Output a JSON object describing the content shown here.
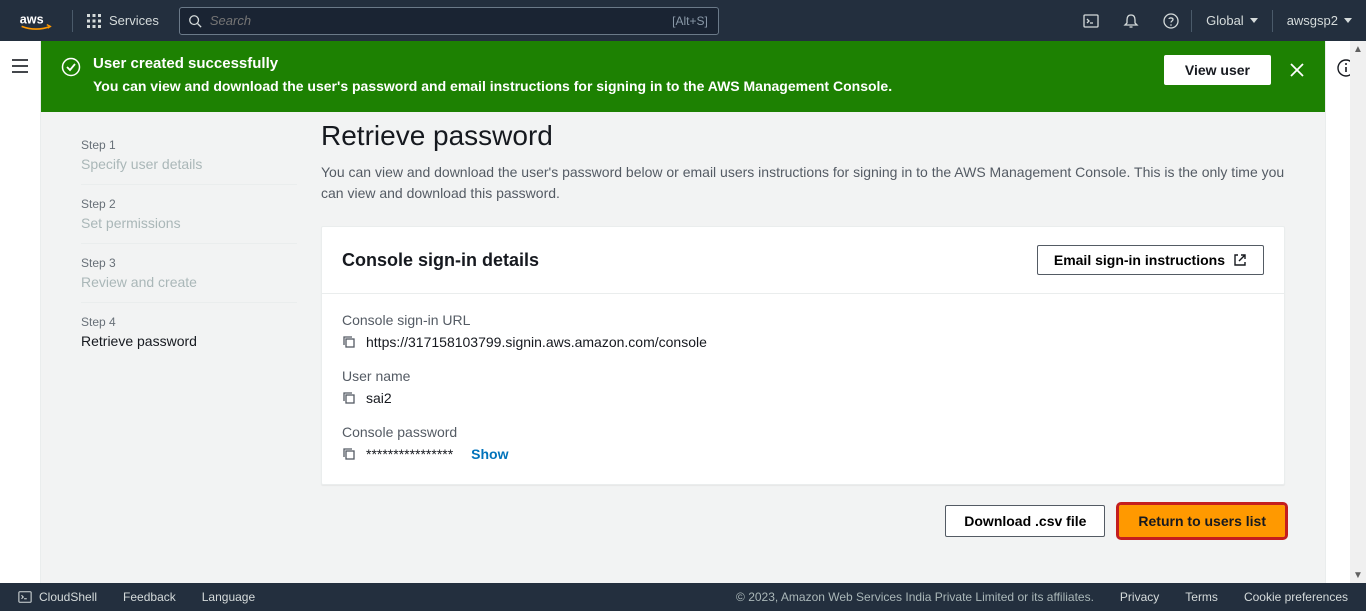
{
  "topnav": {
    "logo_text": "aws",
    "services_label": "Services",
    "search_placeholder": "Search",
    "search_hint": "[Alt+S]",
    "region": "Global",
    "account": "awsgsp2"
  },
  "banner": {
    "title": "User created successfully",
    "message": "You can view and download the user's password and email instructions for signing in to the AWS Management Console.",
    "view_user_label": "View user"
  },
  "steps": [
    {
      "num": "Step 1",
      "title": "Specify user details",
      "active": false
    },
    {
      "num": "Step 2",
      "title": "Set permissions",
      "active": false
    },
    {
      "num": "Step 3",
      "title": "Review and create",
      "active": false
    },
    {
      "num": "Step 4",
      "title": "Retrieve password",
      "active": true
    }
  ],
  "page": {
    "heading": "Retrieve password",
    "description": "You can view and download the user's password below or email users instructions for signing in to the AWS Management Console. This is the only time you can view and download this password."
  },
  "panel": {
    "title": "Console sign-in details",
    "email_btn": "Email sign-in instructions",
    "fields": {
      "signin_url_label": "Console sign-in URL",
      "signin_url_value": "https://317158103799.signin.aws.amazon.com/console",
      "username_label": "User name",
      "username_value": "sai2",
      "password_label": "Console password",
      "password_value": "****************",
      "show_label": "Show"
    }
  },
  "footer_btns": {
    "download": "Download .csv file",
    "return": "Return to users list"
  },
  "bottombar": {
    "cloudshell": "CloudShell",
    "feedback": "Feedback",
    "language": "Language",
    "copyright": "© 2023, Amazon Web Services India Private Limited or its affiliates.",
    "privacy": "Privacy",
    "terms": "Terms",
    "cookie": "Cookie preferences"
  }
}
